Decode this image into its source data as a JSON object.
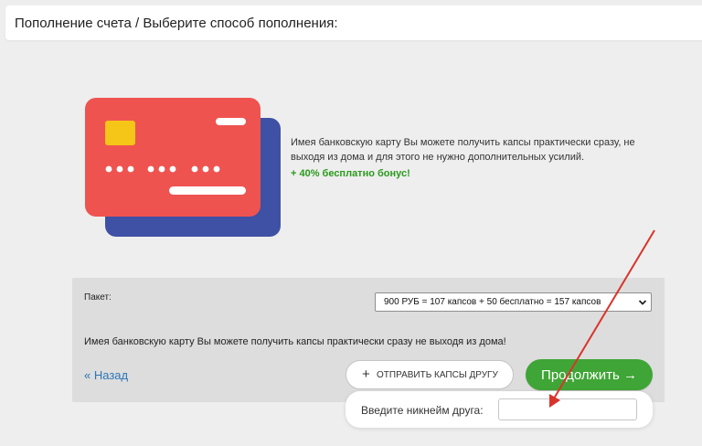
{
  "header": {
    "title": "Пополнение счета / Выберите способ пополнения:"
  },
  "promo": {
    "description": "Имея банковскую карту Вы можете получить капсы практически сразу, не выходя из дома и для этого не нужно дополнительных усилий.",
    "bonus": "+ 40% бесплатно бонус!",
    "card_colors": {
      "front": "#ef5350",
      "back": "#3f51a5",
      "chip": "#f5c518"
    }
  },
  "panel": {
    "package_label": "Пакет:",
    "package_selected": "900 РУБ = 107 капсов + 50 бесплатно = 157 капсов",
    "note": "Имея банковскую карту Вы можете получить капсы практически сразу не выходя из дома!",
    "back_link": "« Назад",
    "send_gift_label": "ОТПРАВИТЬ КАПСЫ ДРУГУ",
    "send_gift_icon": "plus-icon",
    "continue_label": "Продолжить →",
    "continue_color": "#3fa536"
  },
  "friend": {
    "label": "Введите никнейм друга:",
    "input_value": "",
    "input_placeholder": ""
  },
  "annotation": {
    "arrow_color": "#d9342b"
  }
}
